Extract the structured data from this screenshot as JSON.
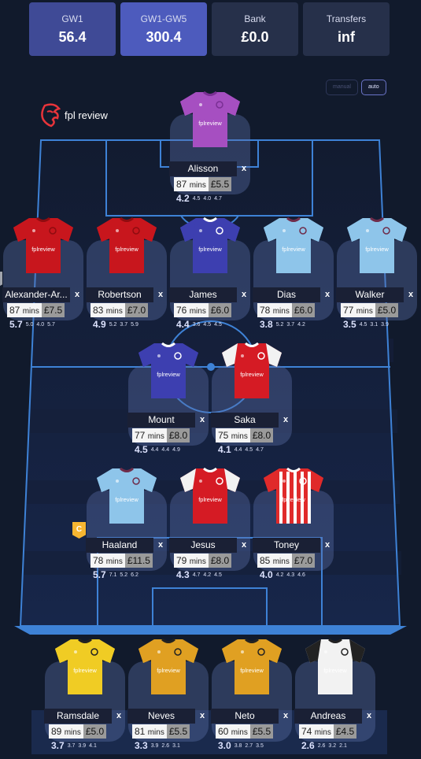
{
  "stats": [
    {
      "label": "GW1",
      "value": "56.4"
    },
    {
      "label": "GW1-GW5",
      "value": "300.4"
    },
    {
      "label": "Bank",
      "value": "£0.0"
    },
    {
      "label": "Transfers",
      "value": "inf"
    }
  ],
  "toggle": {
    "manual": "manual",
    "auto": "auto"
  },
  "logo": {
    "text": "fpl review"
  },
  "shirt_text": "fplreview",
  "remove_label": "x",
  "mins_unit": "mins",
  "players": [
    {
      "name": "Alisson",
      "mins": "87",
      "price": "£5.5",
      "main": "4.2",
      "p1": "4.5",
      "p2": "4.0",
      "p3": "4.7",
      "kit": "purple",
      "badge": ""
    },
    {
      "name": "Alexander-Ar...",
      "mins": "87",
      "price": "£7.5",
      "main": "5.7",
      "p1": "5.0",
      "p2": "4.0",
      "p3": "5.7",
      "kit": "red",
      "badge": "V"
    },
    {
      "name": "Robertson",
      "mins": "83",
      "price": "£7.0",
      "main": "4.9",
      "p1": "5.2",
      "p2": "3.7",
      "p3": "5.9",
      "kit": "red",
      "badge": ""
    },
    {
      "name": "James",
      "mins": "76",
      "price": "£6.0",
      "main": "4.4",
      "p1": "3.6",
      "p2": "4.5",
      "p3": "4.5",
      "kit": "blue",
      "badge": ""
    },
    {
      "name": "Dias",
      "mins": "78",
      "price": "£6.0",
      "main": "3.8",
      "p1": "5.2",
      "p2": "3.7",
      "p3": "4.2",
      "kit": "sky",
      "badge": ""
    },
    {
      "name": "Walker",
      "mins": "77",
      "price": "£5.0",
      "main": "3.5",
      "p1": "4.5",
      "p2": "3.1",
      "p3": "3.9",
      "kit": "sky",
      "badge": ""
    },
    {
      "name": "Mount",
      "mins": "77",
      "price": "£8.0",
      "main": "4.5",
      "p1": "4.4",
      "p2": "4.4",
      "p3": "4.9",
      "kit": "blue",
      "badge": ""
    },
    {
      "name": "Saka",
      "mins": "75",
      "price": "£8.0",
      "main": "4.1",
      "p1": "4.4",
      "p2": "4.5",
      "p3": "4.7",
      "kit": "arsenal",
      "badge": ""
    },
    {
      "name": "Haaland",
      "mins": "78",
      "price": "£11.5",
      "main": "5.7",
      "p1": "7.1",
      "p2": "5.2",
      "p3": "6.2",
      "kit": "sky",
      "badge": "C"
    },
    {
      "name": "Jesus",
      "mins": "79",
      "price": "£8.0",
      "main": "4.3",
      "p1": "4.7",
      "p2": "4.2",
      "p3": "4.5",
      "kit": "arsenal",
      "badge": ""
    },
    {
      "name": "Toney",
      "mins": "85",
      "price": "£7.0",
      "main": "4.0",
      "p1": "4.2",
      "p2": "4.3",
      "p3": "4.6",
      "kit": "stripes",
      "badge": ""
    },
    {
      "name": "Ramsdale",
      "mins": "89",
      "price": "£5.0",
      "main": "3.7",
      "p1": "3.7",
      "p2": "3.9",
      "p3": "4.1",
      "kit": "yellow",
      "badge": ""
    },
    {
      "name": "Neves",
      "mins": "81",
      "price": "£5.5",
      "main": "3.3",
      "p1": "3.9",
      "p2": "2.6",
      "p3": "3.1",
      "kit": "gold",
      "badge": ""
    },
    {
      "name": "Neto",
      "mins": "60",
      "price": "£5.5",
      "main": "3.0",
      "p1": "3.8",
      "p2": "2.7",
      "p3": "3.5",
      "kit": "gold",
      "badge": ""
    },
    {
      "name": "Andreas",
      "mins": "74",
      "price": "£4.5",
      "main": "2.6",
      "p1": "2.6",
      "p2": "3.2",
      "p3": "2.1",
      "kit": "white",
      "badge": ""
    }
  ],
  "kit_colors": {
    "purple": {
      "body": "#a64fc1",
      "sleeve": "#a64fc1",
      "collar": "#7a2f94"
    },
    "red": {
      "body": "#c8161d",
      "sleeve": "#c8161d",
      "collar": "#8f0c10"
    },
    "blue": {
      "body": "#3d3fb0",
      "sleeve": "#3d3fb0",
      "collar": "#ffffff"
    },
    "sky": {
      "body": "#8ec5ea",
      "sleeve": "#8ec5ea",
      "collar": "#6f2c4a"
    },
    "arsenal": {
      "body": "#d51b24",
      "sleeve": "#f2f2f2",
      "collar": "#ffffff"
    },
    "stripes": {
      "body": "#e02a2a",
      "sleeve": "#e02a2a",
      "collar": "#ffffff"
    },
    "yellow": {
      "body": "#f0cc24",
      "sleeve": "#f0cc24",
      "collar": "#222222"
    },
    "gold": {
      "body": "#e0a022",
      "sleeve": "#e0a022",
      "collar": "#222222"
    },
    "white": {
      "body": "#f2f2f2",
      "sleeve": "#222222",
      "collar": "#222222"
    }
  }
}
